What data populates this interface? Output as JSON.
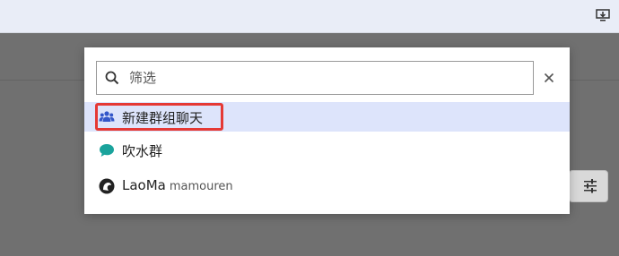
{
  "colors": {
    "overlay": "#6e6e6e",
    "selected_bg": "#dde4fb",
    "group_icon": "#3356c9",
    "chat_icon": "#1aa39c",
    "highlight": "#e53935"
  },
  "search": {
    "placeholder": "筛选",
    "value": ""
  },
  "list": {
    "items": [
      {
        "label": "新建群组聊天",
        "sub": "",
        "icon": "people-group-icon",
        "selected": true
      },
      {
        "label": "吹水群",
        "sub": "",
        "icon": "chat-bubble-icon",
        "selected": false
      },
      {
        "label": "LaoMa",
        "sub": "mamouren",
        "icon": "user-avatar-icon",
        "selected": false
      }
    ]
  }
}
